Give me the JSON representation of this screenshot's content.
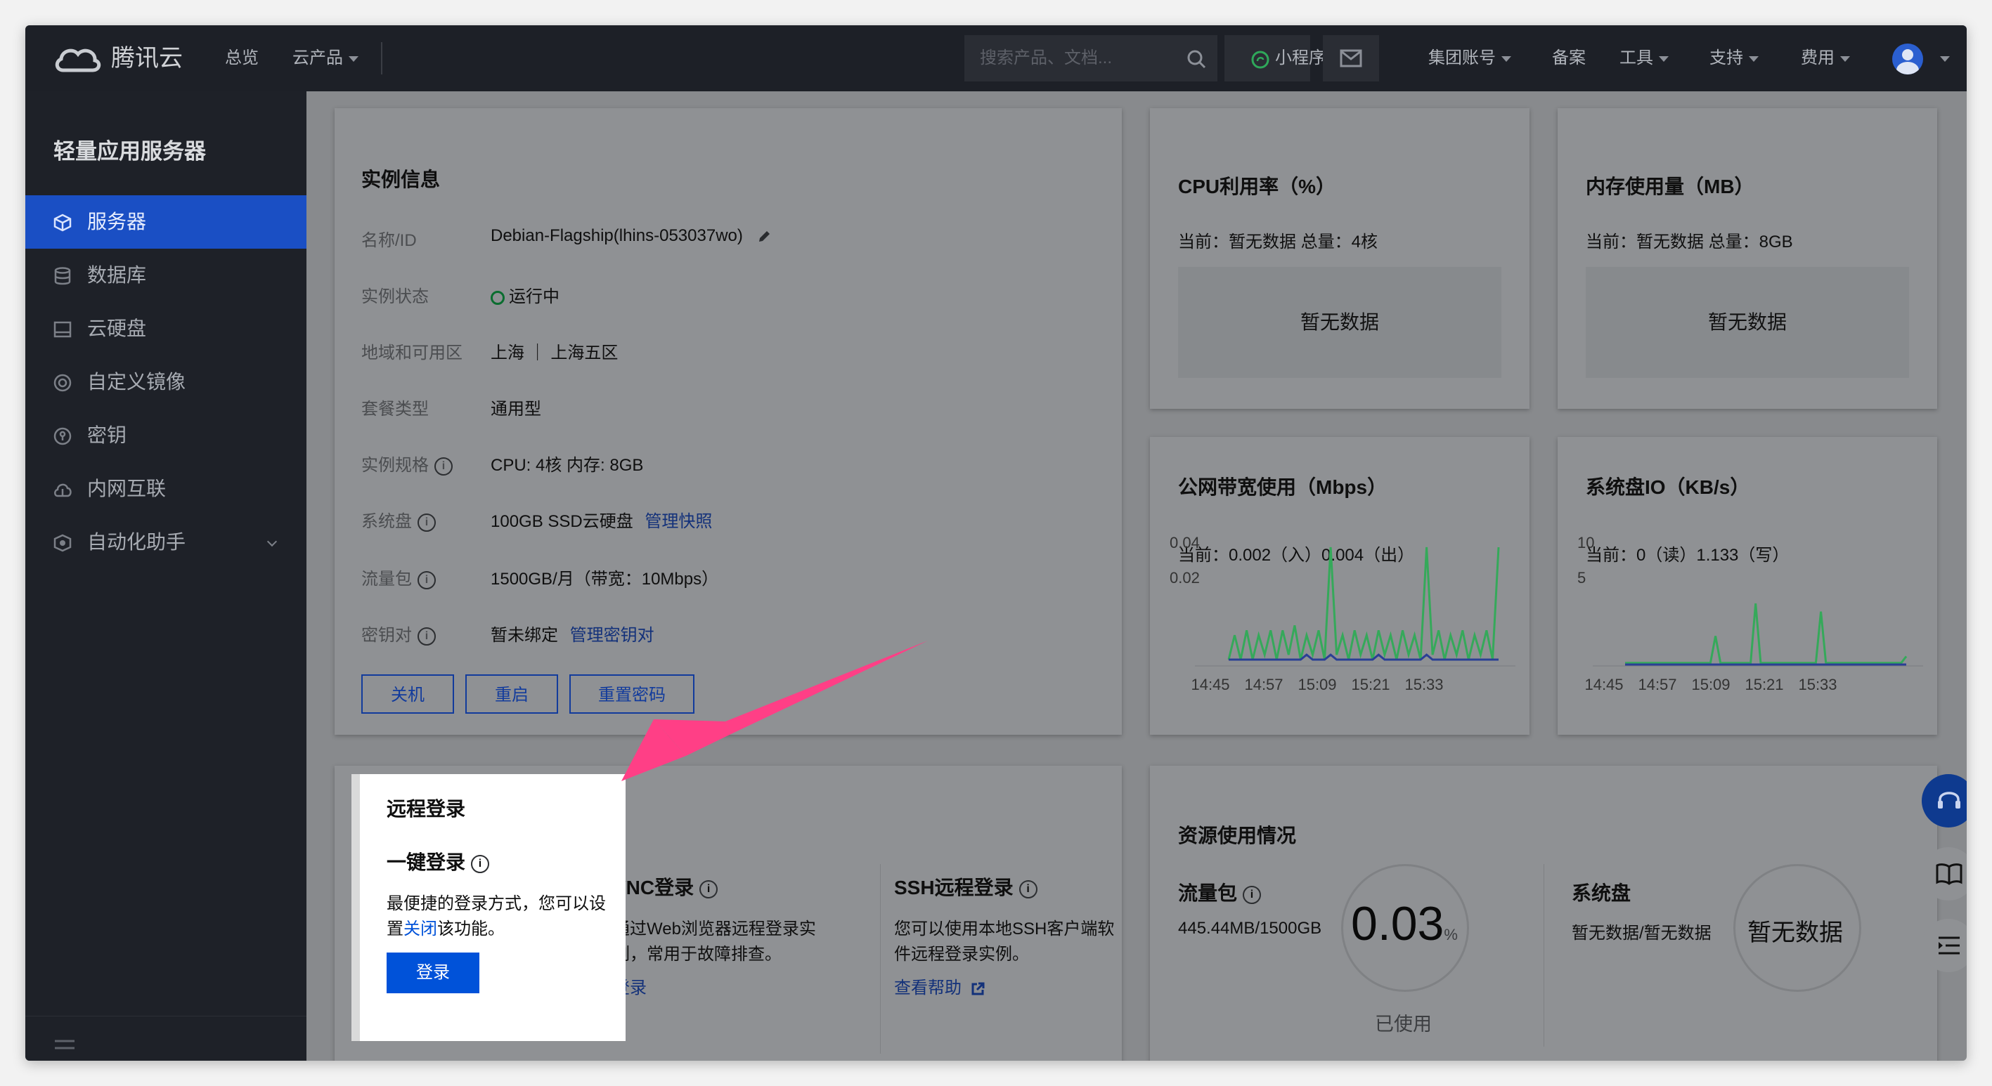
{
  "topbar": {
    "brand": "腾讯云",
    "nav": [
      "总览",
      "云产品"
    ],
    "search_placeholder": "搜索产品、文档...",
    "mini_program": "小程序",
    "group_account": "集团账号",
    "filing": "备案",
    "tools": "工具",
    "support": "支持",
    "billing": "费用"
  },
  "sidebar": {
    "title": "轻量应用服务器",
    "items": [
      {
        "label": "服务器",
        "icon": "cube-icon",
        "active": true
      },
      {
        "label": "数据库",
        "icon": "database-icon"
      },
      {
        "label": "云硬盘",
        "icon": "disk-icon"
      },
      {
        "label": "自定义镜像",
        "icon": "image-icon"
      },
      {
        "label": "密钥",
        "icon": "key-icon"
      },
      {
        "label": "内网互联",
        "icon": "network-icon"
      },
      {
        "label": "自动化助手",
        "icon": "automation-icon"
      }
    ]
  },
  "instance": {
    "title": "实例信息",
    "rows": [
      {
        "label": "名称/ID",
        "value": "Debian-Flagship(lhins-053037wo)"
      },
      {
        "label": "实例状态",
        "value": "运行中"
      },
      {
        "label": "地域和可用区",
        "value": "上海 ｜ 上海五区"
      },
      {
        "label": "套餐类型",
        "value": "通用型"
      },
      {
        "label": "实例规格",
        "value": "CPU: 4核 内存: 8GB"
      },
      {
        "label": "系统盘",
        "value": "100GB SSD云硬盘",
        "link": "管理快照"
      },
      {
        "label": "流量包",
        "value": "1500GB/月（带宽：10Mbps）"
      },
      {
        "label": "密钥对",
        "value": "暂未绑定",
        "link": "管理密钥对"
      }
    ],
    "buttons": [
      "关机",
      "重启",
      "重置密码"
    ]
  },
  "cpu": {
    "title": "CPU利用率（%）",
    "current": "当前：暂无数据 总量：4核",
    "nodata": "暂无数据"
  },
  "mem": {
    "title": "内存使用量（MB）",
    "current": "当前：暂无数据 总量：8GB",
    "nodata": "暂无数据"
  },
  "bandwidth": {
    "title": "公网带宽使用（Mbps）",
    "current": "当前：0.002（入）0.004（出）"
  },
  "diskio": {
    "title": "系统盘IO（KB/s）",
    "current": "当前：0（读）1.133（写）"
  },
  "chart_data": [
    {
      "type": "line",
      "title": "公网带宽使用（Mbps）",
      "x_ticks": [
        "14:45",
        "14:57",
        "15:09",
        "15:21",
        "15:33"
      ],
      "y_ticks": [
        "0.04",
        "0.02"
      ],
      "ylim": [
        0,
        0.04
      ],
      "series": [
        {
          "color": "#35a95a",
          "values": [
            0.001,
            0.006,
            0.001,
            0.007,
            0.001,
            0.006,
            0.002,
            0.007,
            0.001,
            0.007,
            0.002,
            0.008,
            0.001,
            0.006,
            0.002,
            0.007,
            0.001,
            0.024,
            0.002,
            0.006,
            0.001,
            0.007,
            0.002,
            0.006,
            0.001,
            0.007,
            0.002,
            0.006,
            0.001,
            0.007,
            0.002,
            0.006,
            0.001,
            0.024,
            0.002,
            0.007,
            0.001,
            0.006,
            0.002,
            0.007,
            0.001,
            0.006,
            0.002,
            0.007,
            0.001,
            0.024
          ]
        },
        {
          "color": "#2a3f95",
          "values": [
            0.001,
            0.001,
            0.001,
            0.001,
            0.001,
            0.001,
            0.001,
            0.001,
            0.001,
            0.001,
            0.001,
            0.001,
            0.001,
            0.002,
            0.001,
            0.001,
            0.001,
            0.002,
            0.001,
            0.001,
            0.001,
            0.001,
            0.001,
            0.001,
            0.001,
            0.002,
            0.001,
            0.001,
            0.001,
            0.001,
            0.001,
            0.001,
            0.001,
            0.002,
            0.001,
            0.001,
            0.001,
            0.001,
            0.001,
            0.001,
            0.001,
            0.001,
            0.001,
            0.001,
            0.001,
            0.001
          ]
        }
      ]
    },
    {
      "type": "line",
      "title": "系统盘IO（KB/s）",
      "x_ticks": [
        "14:45",
        "14:57",
        "15:09",
        "15:21",
        "15:33"
      ],
      "y_ticks": [
        "10",
        "5"
      ],
      "ylim": [
        0,
        10
      ],
      "series": [
        {
          "color": "#35a95a",
          "values": [
            0.2,
            0.2,
            0.2,
            0.2,
            0.2,
            0.2,
            0.2,
            0.2,
            0.2,
            0.2,
            0.2,
            0.2,
            0.2,
            0.2,
            0.2,
            0.2,
            0.2,
            0.2,
            3.5,
            0.2,
            0.2,
            0.2,
            0.2,
            0.2,
            0.2,
            0.2,
            7.5,
            0.2,
            0.2,
            0.2,
            0.2,
            0.2,
            0.2,
            0.2,
            0.2,
            0.2,
            0.2,
            0.2,
            0.2,
            6.5,
            0.2,
            0.2,
            0.2,
            0.2,
            0.2,
            0.2,
            0.2,
            0.2,
            0.2,
            0.2,
            0.2,
            0.2,
            0.2,
            0.2,
            0.2,
            0.2,
            1.0
          ]
        },
        {
          "color": "#2a3f95",
          "values": [
            0,
            0,
            0,
            0,
            0,
            0,
            0,
            0,
            0,
            0,
            0,
            0,
            0,
            0,
            0,
            0,
            0,
            0,
            0,
            0,
            0,
            0,
            0,
            0,
            0,
            0,
            0,
            0,
            0,
            0,
            0,
            0,
            0,
            0,
            0,
            0,
            0,
            0,
            0,
            0,
            0,
            0,
            0,
            0,
            0,
            0,
            0,
            0,
            0,
            0,
            0,
            0,
            0,
            0,
            0,
            0,
            0
          ]
        }
      ]
    }
  ],
  "remote": {
    "title": "远程登录",
    "onekey_title": "一键登录",
    "onekey_desc_1": "最便捷的登录方式，您可以设",
    "onekey_desc_2a": "置",
    "onekey_desc_link": "关闭",
    "onekey_desc_2b": "该功能。",
    "login_button": "登录",
    "vnc_title": "VNC登录",
    "vnc_desc_1": "通过Web浏览器远程登录实",
    "vnc_desc_2": "例，常用于故障排查。",
    "vnc_link": "登录",
    "ssh_title": "SSH远程登录",
    "ssh_desc_1": "您可以使用本地SSH客户端软",
    "ssh_desc_2": "件远程登录实例。",
    "ssh_link": "查看帮助"
  },
  "resources": {
    "title": "资源使用情况",
    "traffic_title": "流量包",
    "traffic_value": "445.44MB/1500GB",
    "traffic_percent": "0.03",
    "traffic_percent_unit": "%",
    "traffic_used_label": "已使用",
    "disk_title": "系统盘",
    "disk_value": "暂无数据/暂无数据",
    "disk_circle": "暂无数据"
  }
}
